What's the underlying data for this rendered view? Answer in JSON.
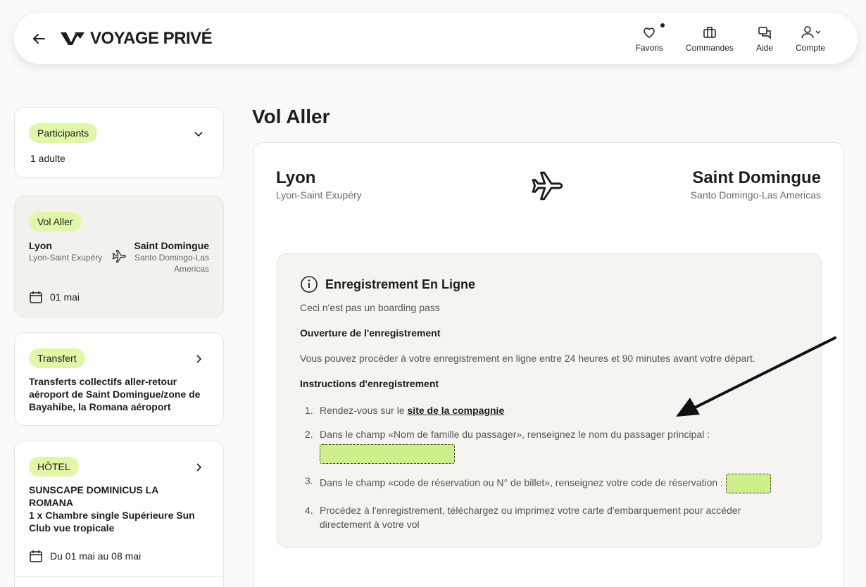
{
  "header": {
    "brand": "VOYAGE PRIVÉ",
    "nav": [
      {
        "label": "Favoris",
        "icon": "heart-icon"
      },
      {
        "label": "Commandes",
        "icon": "briefcase-icon"
      },
      {
        "label": "Aide",
        "icon": "chat-icon"
      },
      {
        "label": "Compte",
        "icon": "user-icon"
      }
    ]
  },
  "sidebar": {
    "participants": {
      "label": "Participants",
      "value": "1 adulte"
    },
    "vol": {
      "label": "Vol Aller",
      "from_city": "Lyon",
      "from_airport": "Lyon-Saint Exupéry",
      "to_city": "Saint Domingue",
      "to_airport_l1": "Santo Domingo-Las",
      "to_airport_l2": "Americas",
      "date": "01 mai"
    },
    "transfert": {
      "label": "Transfert",
      "line1": "Transferts collectifs aller-retour",
      "line2": "aéroport de Saint Domingue/zone de",
      "line3": "Bayahibe, la Romana aéroport"
    },
    "hotel": {
      "label": "HÔTEL",
      "line1": "SUNSCAPE DOMINICUS LA",
      "line2": "ROMANA",
      "line3": "1 x Chambre single Supérieure Sun",
      "line4": "Club vue tropicale",
      "dates": "Du 01 mai au 08 mai"
    }
  },
  "main": {
    "title": "Vol Aller",
    "from_city": "Lyon",
    "from_airport": "Lyon-Saint Exupéry",
    "to_city": "Saint Domingue",
    "to_airport": "Santo Domingo-Las Americas",
    "checkin": {
      "title": "Enregistrement En Ligne",
      "note": "Ceci n'est pas un boarding pass",
      "opening_title": "Ouverture de l'enregistrement",
      "opening_text": "Vous pouvez procéder à votre enregistrement en ligne entre 24 heures et 90 minutes avant votre départ.",
      "instructions_title": "Instructions d'enregistrement",
      "step1_prefix": "Rendez-vous sur le",
      "step1_link": "site de la compagnie",
      "step2": "Dans le champ «Nom de famille du passager», renseignez le nom du passager principal :",
      "step3": "Dans le champ «code de réservation ou N° de billet», renseignez votre code de réservation :",
      "step4_l1": "Procédez à l'enregistrement, téléchargez ou imprimez votre carte d'embarquement pour accéder",
      "step4_l2": "directement à votre vol",
      "numbers": [
        "1.",
        "2.",
        "3.",
        "4."
      ]
    }
  }
}
